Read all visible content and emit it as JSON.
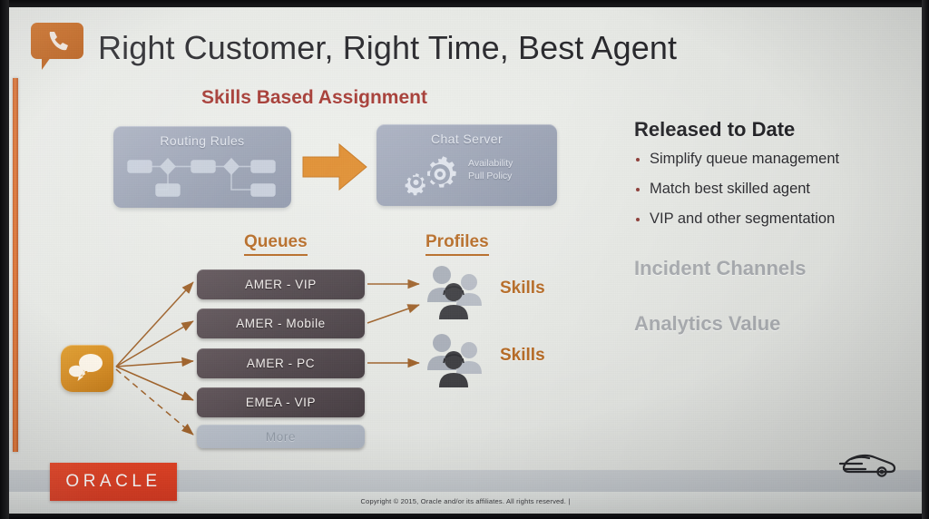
{
  "slide": {
    "title": "Right Customer, Right Time, Best Agent",
    "title_icon": "phone-chat-bubble-icon",
    "section_heading": "Skills Based Assignment"
  },
  "diagram": {
    "routing_box": {
      "label": "Routing Rules",
      "icon": "flowchart-icon"
    },
    "flow_arrow": "right-arrow-icon",
    "chat_box": {
      "label": "Chat Server",
      "icon": "gears-icon",
      "sub_line_1": "Availability",
      "sub_line_2": "Pull Policy"
    },
    "source_icon": "chat-bubbles-icon",
    "columns": {
      "queues_header": "Queues",
      "profiles_header": "Profiles"
    },
    "queues": [
      {
        "label": "AMER - VIP",
        "state": "active"
      },
      {
        "label": "AMER - Mobile",
        "state": "active"
      },
      {
        "label": "AMER - PC",
        "state": "active"
      },
      {
        "label": "EMEA - VIP",
        "state": "active"
      },
      {
        "label": "More",
        "state": "muted"
      }
    ],
    "profiles": [
      {
        "icon": "agent-group-icon",
        "skills_label": "Skills"
      },
      {
        "icon": "agent-group-icon",
        "skills_label": "Skills"
      }
    ]
  },
  "right_column": {
    "released_heading": "Released to Date",
    "released_bullets": [
      "Simplify queue management",
      "Match best skilled agent",
      "VIP and other segmentation"
    ],
    "upcoming": [
      "Incident Channels",
      "Analytics Value"
    ]
  },
  "footer": {
    "logo": "ORACLE",
    "copyright": "Copyright © 2015, Oracle and/or its affiliates. All rights reserved.  |",
    "corner_icon": "car-icon"
  },
  "colors": {
    "accent_orange": "#b5671f",
    "heading_red": "#a4362f",
    "oracle_red": "#d5331a",
    "process_box": "#98a0b2",
    "queue_pill": "#4e4449",
    "dim_gray": "#a9acb0"
  }
}
